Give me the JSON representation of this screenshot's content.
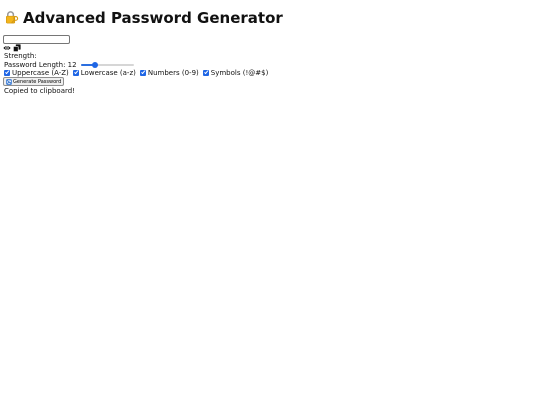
{
  "app": {
    "title": "Advanced Password Generator",
    "title_icon": "lock-with-key-icon"
  },
  "password": {
    "value": "",
    "placeholder": ""
  },
  "icons": {
    "toggle_visibility": "eye-icon",
    "copy": "copy-icon",
    "regenerate": "refresh-icon"
  },
  "strength": {
    "label": "Strength:",
    "value": ""
  },
  "length": {
    "label": "Password Length:",
    "value": "12",
    "slider_fraction": 0.28
  },
  "options": [
    {
      "label": "Uppercase (A-Z)",
      "checked": true
    },
    {
      "label": "Lowercase (a-z)",
      "checked": true
    },
    {
      "label": "Numbers (0-9)",
      "checked": true
    },
    {
      "label": "Symbols (!@#$)",
      "checked": true
    }
  ],
  "generate_button": {
    "label": "Generate Password"
  },
  "status": {
    "message": "Copied to clipboard!"
  },
  "colors": {
    "accent": "#1f66e5",
    "text": "#111111",
    "background": "#ffffff"
  }
}
